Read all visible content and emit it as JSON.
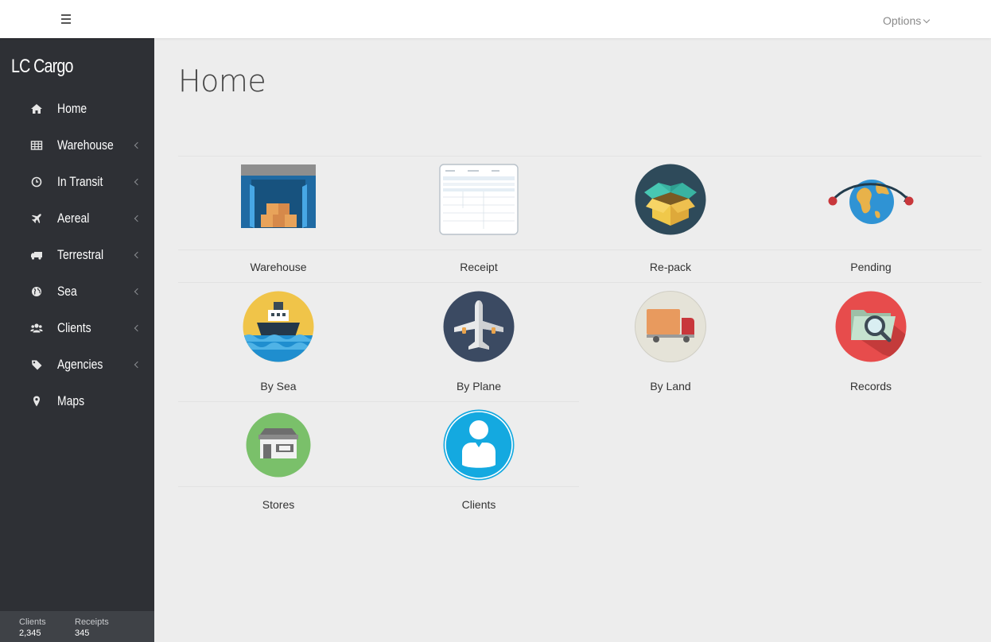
{
  "topbar": {
    "options_label": "Options"
  },
  "sidebar": {
    "brand": "LC Cargo",
    "items": [
      {
        "label": "Home",
        "icon": "home-icon",
        "has_submenu": false
      },
      {
        "label": "Warehouse",
        "icon": "table-icon",
        "has_submenu": true
      },
      {
        "label": "In Transit",
        "icon": "clock-icon",
        "has_submenu": true
      },
      {
        "label": "Aereal",
        "icon": "plane-icon",
        "has_submenu": true
      },
      {
        "label": "Terrestral",
        "icon": "truck-icon",
        "has_submenu": true
      },
      {
        "label": "Sea",
        "icon": "globe-icon",
        "has_submenu": true
      },
      {
        "label": "Clients",
        "icon": "users-icon",
        "has_submenu": true
      },
      {
        "label": "Agencies",
        "icon": "tag-icon",
        "has_submenu": true
      },
      {
        "label": "Maps",
        "icon": "map-marker-icon",
        "has_submenu": false
      }
    ],
    "stats": [
      {
        "label": "Clients",
        "value": "2,345"
      },
      {
        "label": "Receipts",
        "value": "345"
      }
    ]
  },
  "main": {
    "title": "Home",
    "tiles": [
      {
        "label": "Warehouse",
        "icon": "warehouse-icon"
      },
      {
        "label": "Receipt",
        "icon": "receipt-form-icon"
      },
      {
        "label": "Re-pack",
        "icon": "open-box-icon"
      },
      {
        "label": "Pending",
        "icon": "globe-route-icon"
      },
      {
        "label": "By Sea",
        "icon": "ship-icon"
      },
      {
        "label": "By Plane",
        "icon": "airplane-icon"
      },
      {
        "label": "By Land",
        "icon": "truck-icon"
      },
      {
        "label": "Records",
        "icon": "folder-search-icon"
      },
      {
        "label": "Stores",
        "icon": "store-icon"
      },
      {
        "label": "Clients",
        "icon": "user-icon"
      }
    ]
  }
}
